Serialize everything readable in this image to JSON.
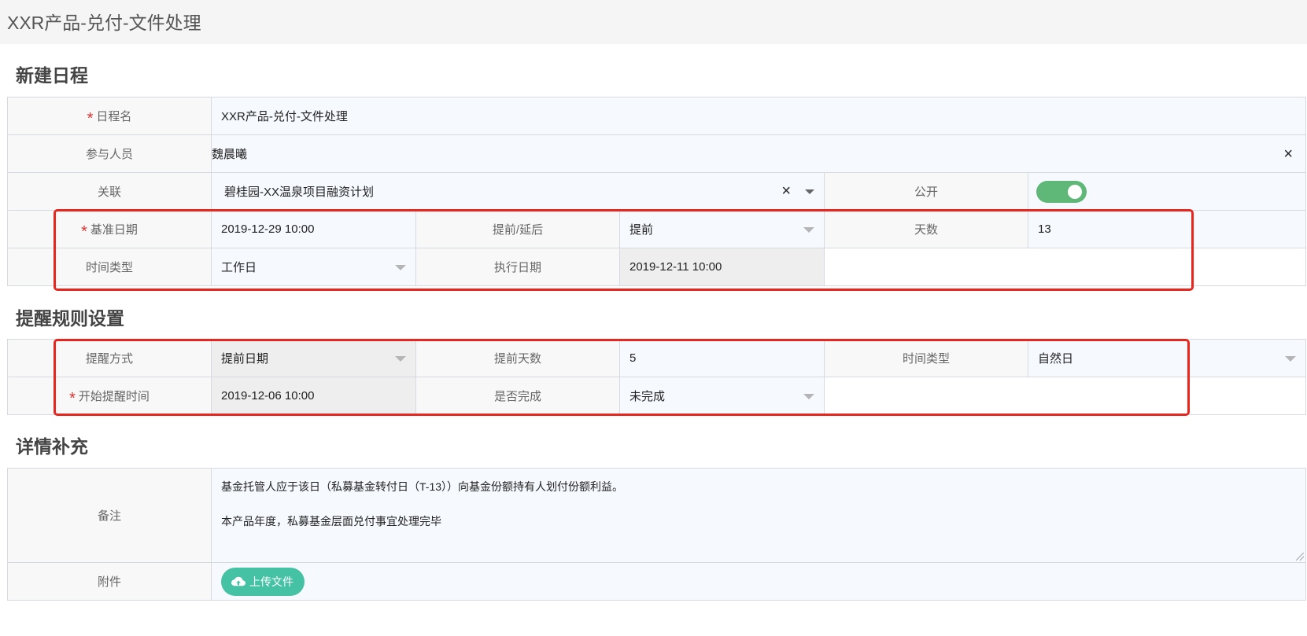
{
  "page": {
    "title": "XXR产品-兑付-文件处理"
  },
  "sections": {
    "schedule": "新建日程",
    "reminder": "提醒规则设置",
    "details": "详情补充"
  },
  "schedule": {
    "name_label": "日程名",
    "name_value": "XXR产品-兑付-文件处理",
    "participants_label": "参与人员",
    "participants_value": "魏晨曦",
    "clear_glyph": "×",
    "relation_label": "关联",
    "relation_value": "碧桂园-XX温泉项目融资计划",
    "public_label": "公开",
    "public_on": true,
    "base_date_label": "基准日期",
    "base_date_value": "2019-12-29 10:00",
    "advance_delay_label": "提前/延后",
    "advance_delay_value": "提前",
    "days_label": "天数",
    "days_value": "13",
    "time_type_label": "时间类型",
    "time_type_value": "工作日",
    "exec_date_label": "执行日期",
    "exec_date_value": "2019-12-11 10:00"
  },
  "reminder": {
    "method_label": "提醒方式",
    "method_value": "提前日期",
    "advance_days_label": "提前天数",
    "advance_days_value": "5",
    "time_type_label": "时间类型",
    "time_type_value": "自然日",
    "start_time_label": "开始提醒时间",
    "start_time_value": "2019-12-06 10:00",
    "completed_label": "是否完成",
    "completed_value": "未完成"
  },
  "details": {
    "remark_label": "备注",
    "remark_line1": "基金托管人应于该日（私募基金转付日（T-13））向基金份额持有人划付份额利益。",
    "remark_line2": "本产品年度，私募基金层面兑付事宜处理完毕",
    "attachment_label": "附件",
    "upload_label": "上传文件"
  },
  "required_mark": "*",
  "colors": {
    "required": "#e03030",
    "toggle": "#5fb878",
    "upload": "#45c1a4",
    "highlight": "#e8261e"
  }
}
